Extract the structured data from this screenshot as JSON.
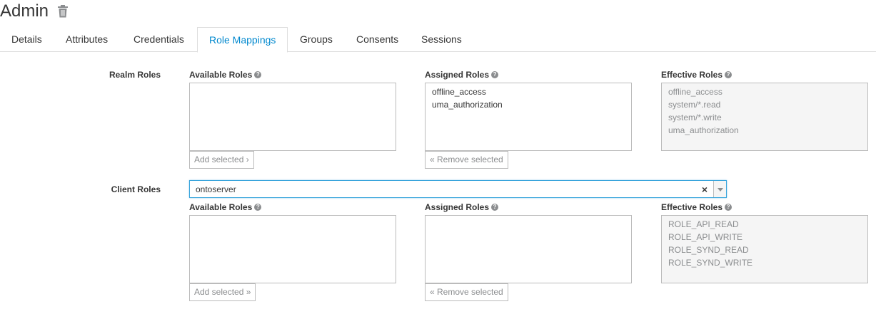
{
  "header": {
    "title": "Admin",
    "delete_icon": "trash-icon"
  },
  "tabs": [
    {
      "label": "Details"
    },
    {
      "label": "Attributes"
    },
    {
      "label": "Credentials"
    },
    {
      "label": "Role Mappings",
      "active": true
    },
    {
      "label": "Groups"
    },
    {
      "label": "Consents"
    },
    {
      "label": "Sessions"
    }
  ],
  "realm_roles": {
    "label": "Realm Roles",
    "available": {
      "heading": "Available Roles",
      "items": [],
      "button": "Add selected ›"
    },
    "assigned": {
      "heading": "Assigned Roles",
      "items": [
        "offline_access",
        "uma_authorization"
      ],
      "button": "« Remove selected"
    },
    "effective": {
      "heading": "Effective Roles",
      "items": [
        "offline_access",
        "system/*.read",
        "system/*.write",
        "uma_authorization"
      ]
    }
  },
  "client_roles": {
    "label": "Client Roles",
    "client_select": {
      "value": "ontoserver",
      "clear": "×"
    },
    "available": {
      "heading": "Available Roles",
      "items": [],
      "button": "Add selected »"
    },
    "assigned": {
      "heading": "Assigned Roles",
      "items": [],
      "button": "« Remove selected"
    },
    "effective": {
      "heading": "Effective Roles",
      "items": [
        "ROLE_API_READ",
        "ROLE_API_WRITE",
        "ROLE_SYND_READ",
        "ROLE_SYND_WRITE"
      ]
    }
  },
  "colors": {
    "accent": "#0088ce",
    "focus_border": "#39a5dc",
    "readonly_bg": "#f5f5f5"
  }
}
